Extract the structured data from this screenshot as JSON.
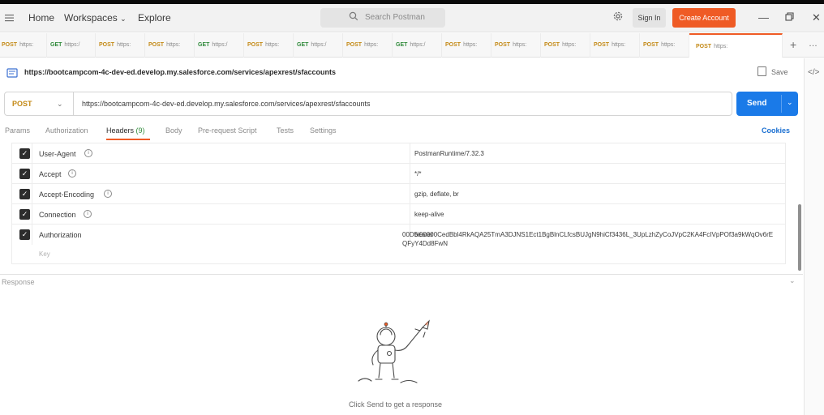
{
  "titlebar": {
    "menu_icon": "hamburger-icon",
    "nav": [
      "Home",
      "Workspaces",
      "Explore"
    ],
    "search_placeholder": "Search Postman",
    "sign_in": "Sign In",
    "create_account": "Create Account"
  },
  "tabs": [
    {
      "method": "POST",
      "label": "https:"
    },
    {
      "method": "GET",
      "label": "https:/"
    },
    {
      "method": "POST",
      "label": "https:"
    },
    {
      "method": "POST",
      "label": "https:"
    },
    {
      "method": "GET",
      "label": "https:/"
    },
    {
      "method": "POST",
      "label": "https:"
    },
    {
      "method": "GET",
      "label": "https:/"
    },
    {
      "method": "POST",
      "label": "https:"
    },
    {
      "method": "GET",
      "label": "https:/"
    },
    {
      "method": "POST",
      "label": "https:"
    },
    {
      "method": "POST",
      "label": "https:"
    },
    {
      "method": "POST",
      "label": "https:"
    },
    {
      "method": "POST",
      "label": "https:"
    },
    {
      "method": "POST",
      "label": "https:"
    },
    {
      "method": "POST",
      "label": "https:"
    }
  ],
  "request": {
    "title": "https://bootcampcom-4c-dev-ed.develop.my.salesforce.com/services/apexrest/sfaccounts",
    "save": "Save",
    "method": "POST",
    "url": "https://bootcampcom-4c-dev-ed.develop.my.salesforce.com/services/apexrest/sfaccounts",
    "send": "Send"
  },
  "subtabs": {
    "params": "Params",
    "authorization": "Authorization",
    "headers": "Headers",
    "headers_count": "(9)",
    "body": "Body",
    "prerequest": "Pre-request Script",
    "tests": "Tests",
    "settings": "Settings",
    "cookies": "Cookies"
  },
  "headers": [
    {
      "key": "User-Agent",
      "value": "PostmanRuntime/7.32.3"
    },
    {
      "key": "Accept",
      "value": "*/*"
    },
    {
      "key": "Accept-Encoding",
      "value": "gzip, deflate, br"
    },
    {
      "key": "Connection",
      "value": "keep-alive"
    },
    {
      "key": "Authorization",
      "value": "bearer"
    }
  ],
  "bearer_token": "00D5i00000CedBbl4RkAQA25TmA3DJNS1Ect1BgBlnCLfcsBUJgN9hiCf3436L_3UpLzhZyCoJVpC2KA4FcIVpPOf3a9kWqOv6rEQFyY4Dd8FwN",
  "key_placeholder": "Key",
  "response": {
    "label": "Response",
    "hint": "Click Send to get a response"
  }
}
